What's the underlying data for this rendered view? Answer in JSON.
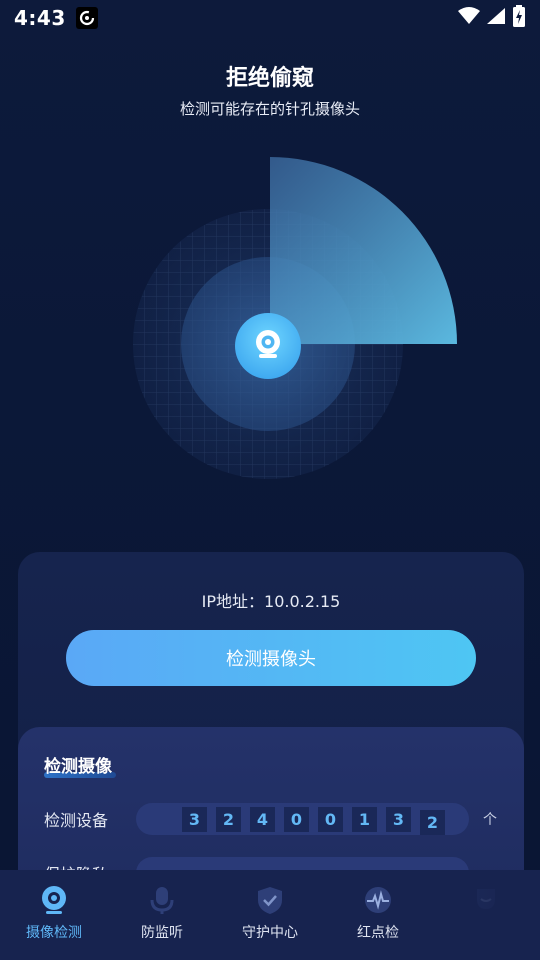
{
  "status_bar": {
    "time": "4:43"
  },
  "header": {
    "title": "拒绝偷窥",
    "subtitle": "检测可能存在的针孔摄像头"
  },
  "main": {
    "ip_text": "IP地址：10.0.2.15",
    "detect_button_label": "检测摄像头"
  },
  "stats": {
    "title": "检测摄像",
    "rows": [
      {
        "label": "检测设备",
        "digits": [
          "3",
          "2",
          "4",
          "0",
          "0",
          "1",
          "3",
          "2"
        ],
        "unit": "个"
      }
    ],
    "partial_row_label": "保护隐私"
  },
  "nav": {
    "items": [
      {
        "label": "摄像检测",
        "icon": "camera-icon",
        "active": true
      },
      {
        "label": "防监听",
        "icon": "microphone-icon",
        "active": false
      },
      {
        "label": "守护中心",
        "icon": "shield-check-icon",
        "active": false
      },
      {
        "label": "红点检",
        "icon": "pulse-icon",
        "active": false
      },
      {
        "label": "",
        "icon": "face-icon",
        "active": false
      }
    ]
  },
  "colors": {
    "background": "#0b1838",
    "accent": "#5fb7f7",
    "button_start": "#5aa8f6",
    "button_end": "#4ec6f3",
    "card": "#16244e",
    "stats_card": "#24326a"
  }
}
